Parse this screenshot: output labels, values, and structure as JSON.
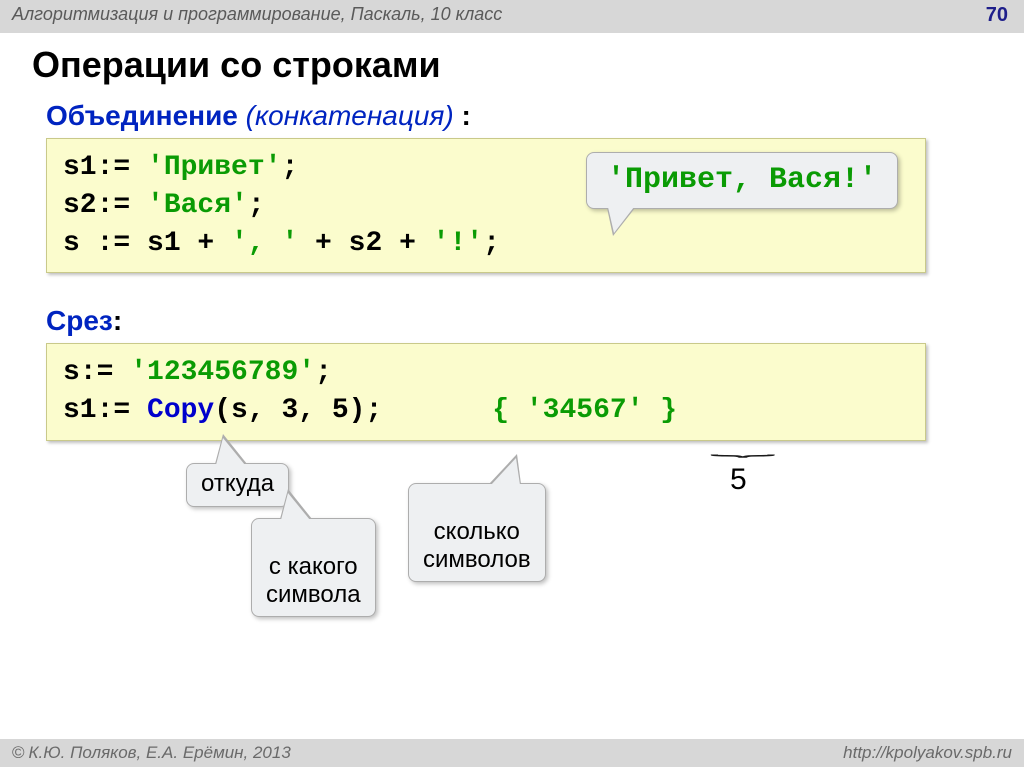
{
  "header": {
    "breadcrumb": "Алгоритмизация и программирование, Паскаль, 10 класс",
    "page_number": "70"
  },
  "title": "Операции со строками",
  "section1": {
    "label_bold": "Объединение",
    "label_italic": " (конкатенация) ",
    "colon": ":",
    "code": {
      "l1a": "s1:= ",
      "l1b": "'Привет'",
      "l1c": ";",
      "l2a": "s2:= ",
      "l2b": "'Вася'",
      "l2c": ";",
      "l3a": "s := s1 + ",
      "l3b": "', '",
      "l3c": " + s2 + ",
      "l3d": "'!'",
      "l3e": ";"
    },
    "callout_result": "'Привет, Вася!'"
  },
  "section2": {
    "label": "Срез",
    "colon": ":",
    "code": {
      "l1a": "s:= ",
      "l1b": "'123456789'",
      "l1c": ";",
      "l2a": "s1:= ",
      "l2b": "Copy",
      "l2c": "(s, 3, 5);",
      "l2_comment": "{ '34567' }"
    },
    "callout_from": "откуда",
    "callout_fromchar": "с какого\nсимвола",
    "callout_count": "сколько\nсимволов",
    "brace_number": "5"
  },
  "footer": {
    "left": "К.Ю. Поляков, Е.А. Ерёмин, 2013",
    "right": "http://kpolyakov.spb.ru"
  }
}
